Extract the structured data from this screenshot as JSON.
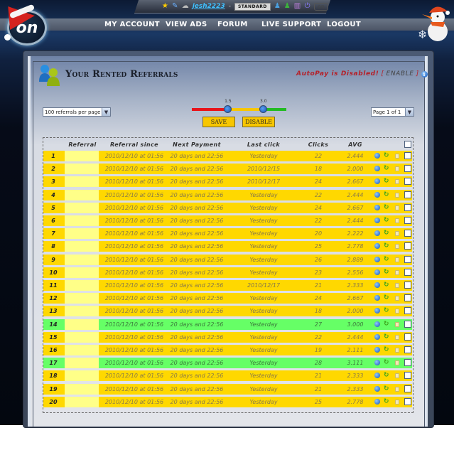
{
  "header": {
    "username": "jesh2223",
    "separator": "-",
    "membership_badge": "STANDARD",
    "logo_text": "on",
    "mini_logo_text": "on"
  },
  "nav": {
    "items": [
      {
        "label": "My Account"
      },
      {
        "label": "View Ads"
      },
      {
        "label": "Forum"
      },
      {
        "label": "Live Support"
      },
      {
        "label": "Logout"
      }
    ]
  },
  "page": {
    "title": "Your Rented Referrals",
    "autopay_message": "AutoPay is Disabled!",
    "autopay_bracket_open": "[",
    "autopay_enable": "ENABLE",
    "autopay_bracket_close": "]"
  },
  "controls": {
    "per_page_value": "100 referrals per page",
    "page_select_value": "Page 1 of 1",
    "slider": {
      "low_label": "1.5",
      "high_label": "3.0",
      "low_value": 1.5,
      "high_value": 3.0
    },
    "save_label": "SAVE",
    "disable_label": "DISABLE",
    "colors": {
      "low": "#e8141a",
      "mid": "#f7c600",
      "high": "#22bb22"
    }
  },
  "table": {
    "columns": [
      "",
      "Referral",
      "Referral since",
      "Next Payment",
      "Last click",
      "Clicks",
      "AVG"
    ],
    "rows": [
      {
        "n": "1",
        "since": "2010/12/10 at 01:56",
        "next": "20 days and 22:56",
        "last": "Yesterday",
        "clicks": "22",
        "avg": "2.444",
        "hl": false
      },
      {
        "n": "2",
        "since": "2010/12/10 at 01:56",
        "next": "20 days and 22:56",
        "last": "2010/12/15",
        "clicks": "18",
        "avg": "2.000",
        "hl": false
      },
      {
        "n": "3",
        "since": "2010/12/10 at 01:56",
        "next": "20 days and 22:56",
        "last": "2010/12/17",
        "clicks": "24",
        "avg": "2.667",
        "hl": false
      },
      {
        "n": "4",
        "since": "2010/12/10 at 01:56",
        "next": "20 days and 22:56",
        "last": "Yesterday",
        "clicks": "22",
        "avg": "2.444",
        "hl": false
      },
      {
        "n": "5",
        "since": "2010/12/10 at 01:56",
        "next": "20 days and 22:56",
        "last": "Yesterday",
        "clicks": "24",
        "avg": "2.667",
        "hl": false
      },
      {
        "n": "6",
        "since": "2010/12/10 at 01:56",
        "next": "20 days and 22:56",
        "last": "Yesterday",
        "clicks": "22",
        "avg": "2.444",
        "hl": false
      },
      {
        "n": "7",
        "since": "2010/12/10 at 01:56",
        "next": "20 days and 22:56",
        "last": "Yesterday",
        "clicks": "20",
        "avg": "2.222",
        "hl": false
      },
      {
        "n": "8",
        "since": "2010/12/10 at 01:56",
        "next": "20 days and 22:56",
        "last": "Yesterday",
        "clicks": "25",
        "avg": "2.778",
        "hl": false
      },
      {
        "n": "9",
        "since": "2010/12/10 at 01:56",
        "next": "20 days and 22:56",
        "last": "Yesterday",
        "clicks": "26",
        "avg": "2.889",
        "hl": false
      },
      {
        "n": "10",
        "since": "2010/12/10 at 01:56",
        "next": "20 days and 22:56",
        "last": "Yesterday",
        "clicks": "23",
        "avg": "2.556",
        "hl": false
      },
      {
        "n": "11",
        "since": "2010/12/10 at 01:56",
        "next": "20 days and 22:56",
        "last": "2010/12/17",
        "clicks": "21",
        "avg": "2.333",
        "hl": false
      },
      {
        "n": "12",
        "since": "2010/12/10 at 01:56",
        "next": "20 days and 22:56",
        "last": "Yesterday",
        "clicks": "24",
        "avg": "2.667",
        "hl": false
      },
      {
        "n": "13",
        "since": "2010/12/10 at 01:56",
        "next": "20 days and 22:56",
        "last": "Yesterday",
        "clicks": "18",
        "avg": "2.000",
        "hl": false
      },
      {
        "n": "14",
        "since": "2010/12/10 at 01:56",
        "next": "20 days and 22:56",
        "last": "Yesterday",
        "clicks": "27",
        "avg": "3.000",
        "hl": true
      },
      {
        "n": "15",
        "since": "2010/12/10 at 01:56",
        "next": "20 days and 22:56",
        "last": "Yesterday",
        "clicks": "22",
        "avg": "2.444",
        "hl": false
      },
      {
        "n": "16",
        "since": "2010/12/10 at 01:56",
        "next": "20 days and 22:56",
        "last": "Yesterday",
        "clicks": "19",
        "avg": "2.111",
        "hl": false
      },
      {
        "n": "17",
        "since": "2010/12/10 at 01:56",
        "next": "20 days and 22:56",
        "last": "Yesterday",
        "clicks": "28",
        "avg": "3.111",
        "hl": true
      },
      {
        "n": "18",
        "since": "2010/12/10 at 01:56",
        "next": "20 days and 22:56",
        "last": "Yesterday",
        "clicks": "21",
        "avg": "2.333",
        "hl": false
      },
      {
        "n": "19",
        "since": "2010/12/10 at 01:56",
        "next": "20 days and 22:56",
        "last": "Yesterday",
        "clicks": "21",
        "avg": "2.333",
        "hl": false
      },
      {
        "n": "20",
        "since": "2010/12/10 at 01:56",
        "next": "20 days and 22:56",
        "last": "Yesterday",
        "clicks": "25",
        "avg": "2.778",
        "hl": false
      }
    ]
  }
}
